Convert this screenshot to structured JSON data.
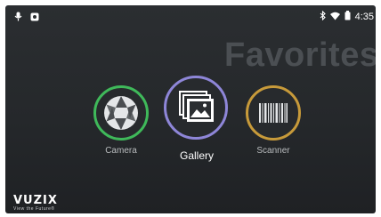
{
  "status_bar": {
    "time": "4:35",
    "left_icons": [
      "mic-icon",
      "record-icon"
    ],
    "right_icons": [
      "bluetooth-icon",
      "wifi-icon",
      "battery-icon"
    ]
  },
  "screen_title": "Favorites",
  "apps": [
    {
      "label": "Camera",
      "icon": "camera-aperture-icon",
      "ring_color": "#3fb95a"
    },
    {
      "label": "Gallery",
      "icon": "gallery-photos-icon",
      "ring_color": "#8e86d8",
      "selected": true
    },
    {
      "label": "Scanner",
      "icon": "barcode-icon",
      "ring_color": "#c79a3a"
    }
  ],
  "brand": {
    "name": "VUZIX",
    "tagline": "View the Future®"
  }
}
